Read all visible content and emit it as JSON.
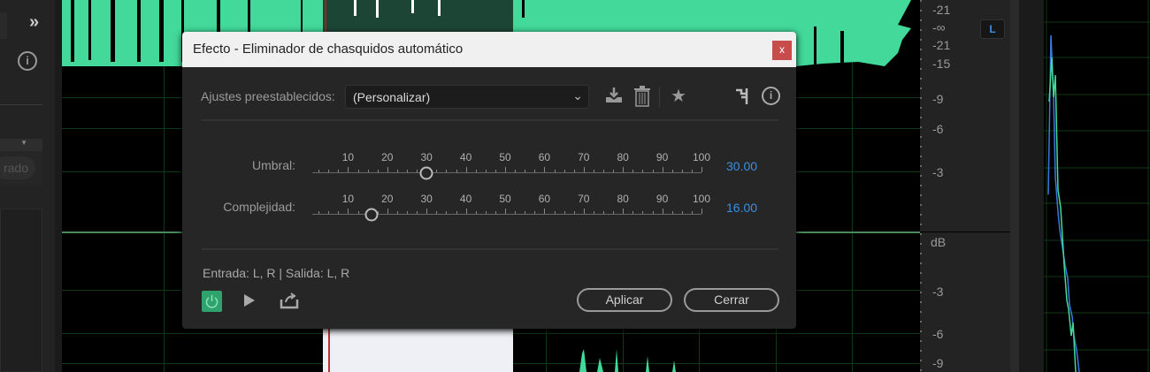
{
  "dialog": {
    "title": "Efecto - Eliminador de chasquidos automático",
    "close_label": "x",
    "presets_label": "Ajustes preestablecidos:",
    "preset_value": "(Personalizar)",
    "sliders": [
      {
        "label": "Umbral:",
        "value": 30,
        "display": "30.00"
      },
      {
        "label": "Complejidad:",
        "value": 16,
        "display": "16.00"
      }
    ],
    "scale_labels": [
      "10",
      "20",
      "30",
      "40",
      "50",
      "60",
      "70",
      "80",
      "90",
      "100"
    ],
    "io_text": "Entrada: L, R | Salida: L, R",
    "apply_label": "Aplicar",
    "close_button_label": "Cerrar"
  },
  "left_panel": {
    "expand_label": "»",
    "button_partial": "rado"
  },
  "ruler": {
    "top_labels": [
      "-21",
      "-∞",
      "-21",
      "-15",
      "-9",
      "-6",
      "-3"
    ],
    "unit": "dB",
    "bottom_labels": [
      "-3",
      "-6",
      "-9"
    ],
    "channel_badge": "L"
  },
  "colors": {
    "waveform": "#42d99a",
    "accent": "#3a8ee6",
    "power": "#2ea36b",
    "close": "#c94c4c"
  }
}
